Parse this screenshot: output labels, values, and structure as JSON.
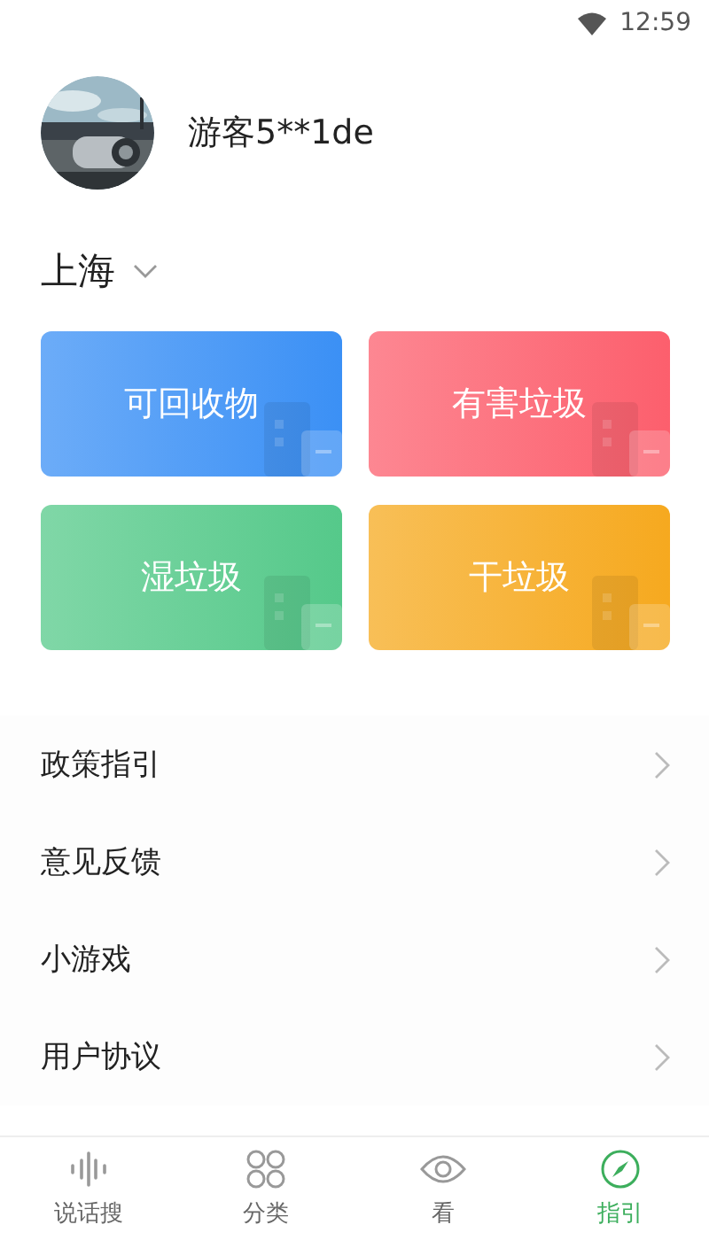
{
  "status_bar": {
    "time": "12:59"
  },
  "profile": {
    "username": "游客5**1de"
  },
  "city": {
    "name": "上海"
  },
  "categories": [
    {
      "label": "可回收物",
      "color": "#3b90f5"
    },
    {
      "label": "有害垃圾",
      "color": "#fc5f6d"
    },
    {
      "label": "湿垃圾",
      "color": "#55c98a"
    },
    {
      "label": "干垃圾",
      "color": "#f6a91f"
    }
  ],
  "menu": [
    {
      "label": "政策指引"
    },
    {
      "label": "意见反馈"
    },
    {
      "label": "小游戏"
    },
    {
      "label": "用户协议"
    }
  ],
  "tab_bar": [
    {
      "label": "说话搜",
      "kind": "voice",
      "selected": false
    },
    {
      "label": "分类",
      "kind": "grid",
      "selected": false
    },
    {
      "label": "看",
      "kind": "eye",
      "selected": false
    },
    {
      "label": "指引",
      "kind": "compass",
      "selected": true
    }
  ]
}
